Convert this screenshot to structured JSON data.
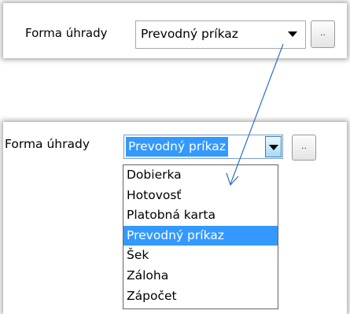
{
  "top": {
    "label": "Forma úhrady",
    "combo_value": "Prevodný príkaz",
    "dots_label": ".."
  },
  "bottom": {
    "label": "Forma úhrady",
    "combo_value": "Prevodný príkaz",
    "dots_label": "..",
    "options": [
      "Dobierka",
      "Hotovosť",
      "Platobná karta",
      "Prevodný príkaz",
      "Šek",
      "Záloha",
      "Zápočet"
    ],
    "selected_index": 3
  },
  "colors": {
    "selection": "#3399ff",
    "annotation_arrow": "#2e6fc4"
  }
}
